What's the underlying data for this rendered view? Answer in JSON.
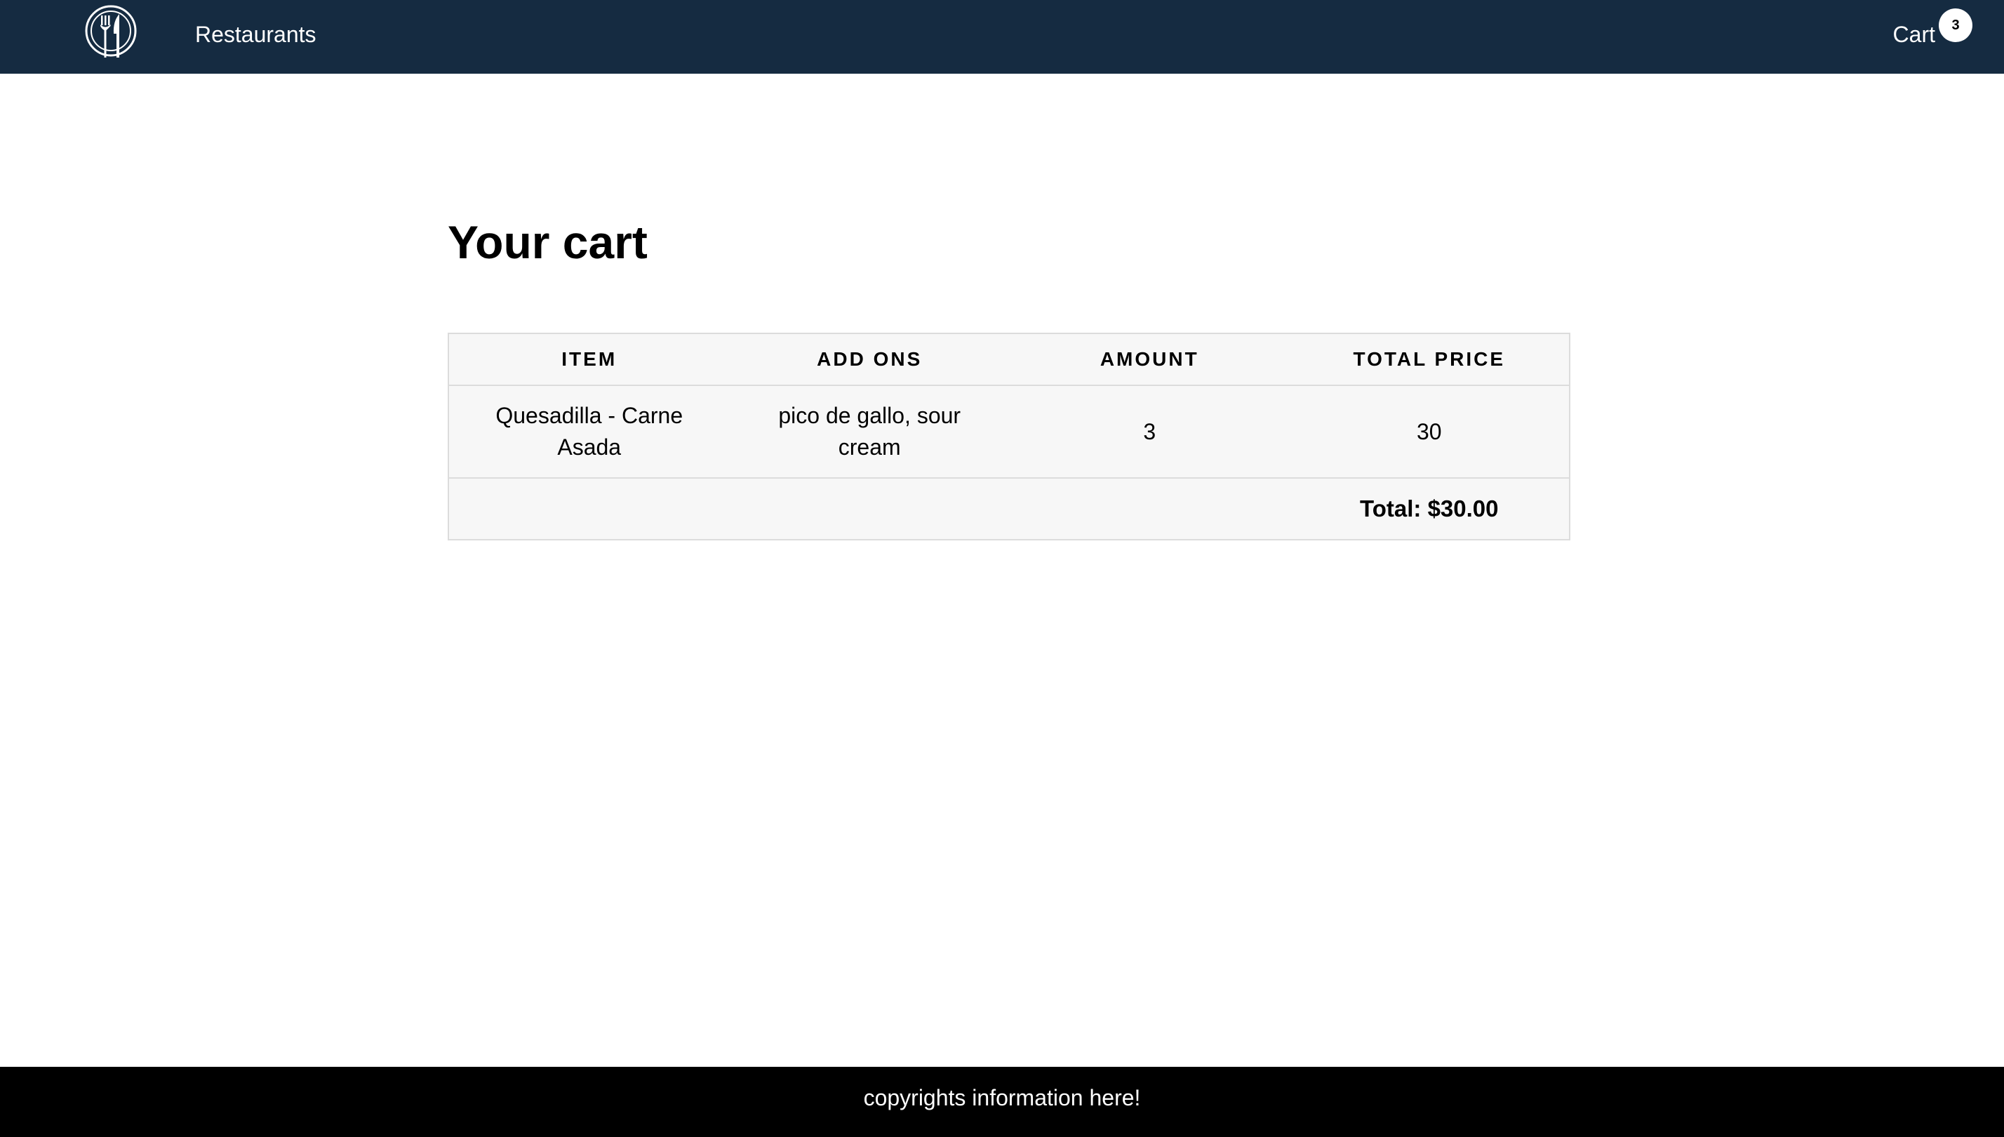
{
  "header": {
    "logo_icon": "fork-knife-plate-icon",
    "nav_restaurants": "Restaurants",
    "cart_label": "Cart",
    "cart_count": "3"
  },
  "main": {
    "title": "Your cart",
    "table": {
      "headers": [
        "ITEM",
        "ADD ONS",
        "AMOUNT",
        "TOTAL PRICE"
      ],
      "rows": [
        {
          "item": "Quesadilla - Carne Asada",
          "addons": "pico de gallo, sour cream",
          "amount": "3",
          "total_price": "30"
        }
      ],
      "total": "Total: $30.00"
    }
  },
  "footer": {
    "text": "copyrights information here!"
  },
  "colors": {
    "header_bg": "#152b41",
    "footer_bg": "#000000",
    "table_bg": "#f7f7f7"
  }
}
